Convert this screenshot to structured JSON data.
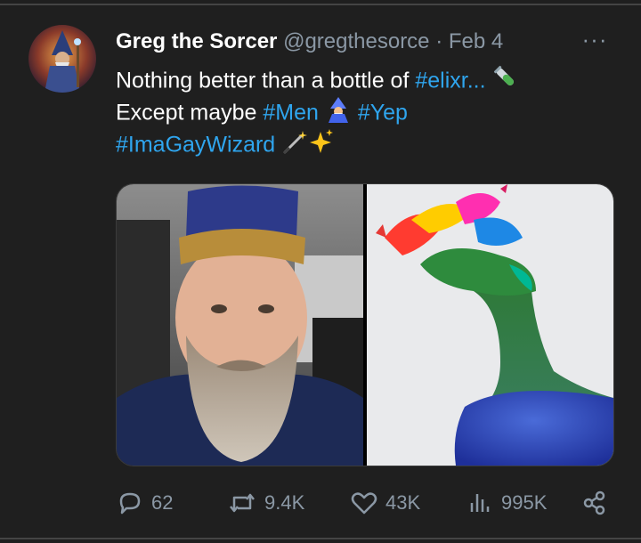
{
  "tweet": {
    "author_name": "Greg the Sorcer",
    "handle": "@gregthesorce",
    "separator": "·",
    "date": "Feb 4",
    "more": "···",
    "text": {
      "line1_plain": "Nothing better than a bottle of ",
      "line1_tag": "#elixr...",
      "line2_plain": "Except maybe ",
      "line2_tag1": "#Men",
      "line2_tag2": "#Yep",
      "line3_tag": "#ImaGayWizard"
    },
    "icons": {
      "test_tube": "test-tube-emoji",
      "wizard": "wizard-emoji",
      "wand": "magic-wand-emoji",
      "sparkles": "sparkles-emoji"
    }
  },
  "actions": {
    "replies": "62",
    "reposts": "9.4K",
    "likes": "43K",
    "views": "995K"
  },
  "colors": {
    "background": "#1f1f1f",
    "text": "#ffffff",
    "muted": "#8b98a5",
    "hashtag": "#2fa5ee"
  }
}
